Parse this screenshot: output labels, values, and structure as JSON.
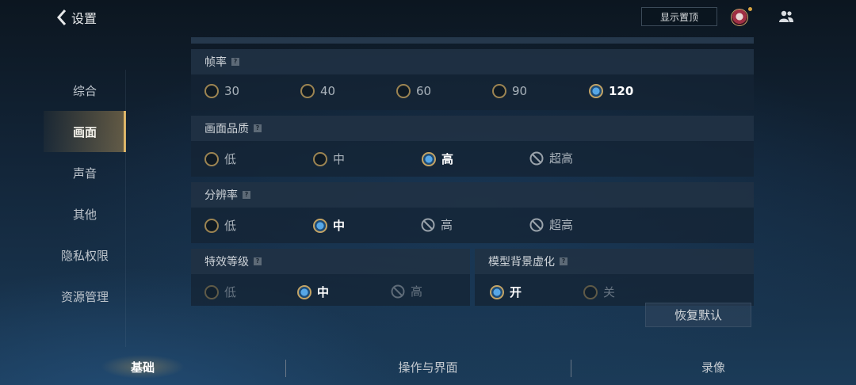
{
  "header": {
    "title": "设置",
    "pin_button": "显示置顶"
  },
  "sidebar": {
    "items": [
      {
        "label": "综合"
      },
      {
        "label": "画面"
      },
      {
        "label": "声音"
      },
      {
        "label": "其他"
      },
      {
        "label": "隐私权限"
      },
      {
        "label": "资源管理"
      }
    ],
    "active_index": 1
  },
  "sections": {
    "framerate": {
      "title": "帧率",
      "options": [
        "30",
        "40",
        "60",
        "90",
        "120"
      ],
      "selected": "120"
    },
    "quality": {
      "title": "画面品质",
      "options": [
        "低",
        "中",
        "高",
        "超高"
      ],
      "selected": "高",
      "disabled": [
        "超高"
      ]
    },
    "resolution": {
      "title": "分辨率",
      "options": [
        "低",
        "中",
        "高",
        "超高"
      ],
      "selected": "中",
      "disabled": [
        "高",
        "超高"
      ]
    },
    "effects": {
      "title": "特效等级",
      "options": [
        "低",
        "中",
        "高"
      ],
      "selected": "中",
      "disabled": [
        "高"
      ]
    },
    "blur": {
      "title": "模型背景虚化",
      "options": [
        "开",
        "关"
      ],
      "selected": "开"
    }
  },
  "help_mark": "?",
  "reset_button": "恢复默认",
  "tabs": [
    {
      "label": "基础"
    },
    {
      "label": "操作与界面"
    },
    {
      "label": "录像"
    }
  ],
  "active_tab": "基础",
  "colors": {
    "accent_gold": "#e0b766",
    "selected_blue": "#57a7e6",
    "panel": "#14243a"
  }
}
